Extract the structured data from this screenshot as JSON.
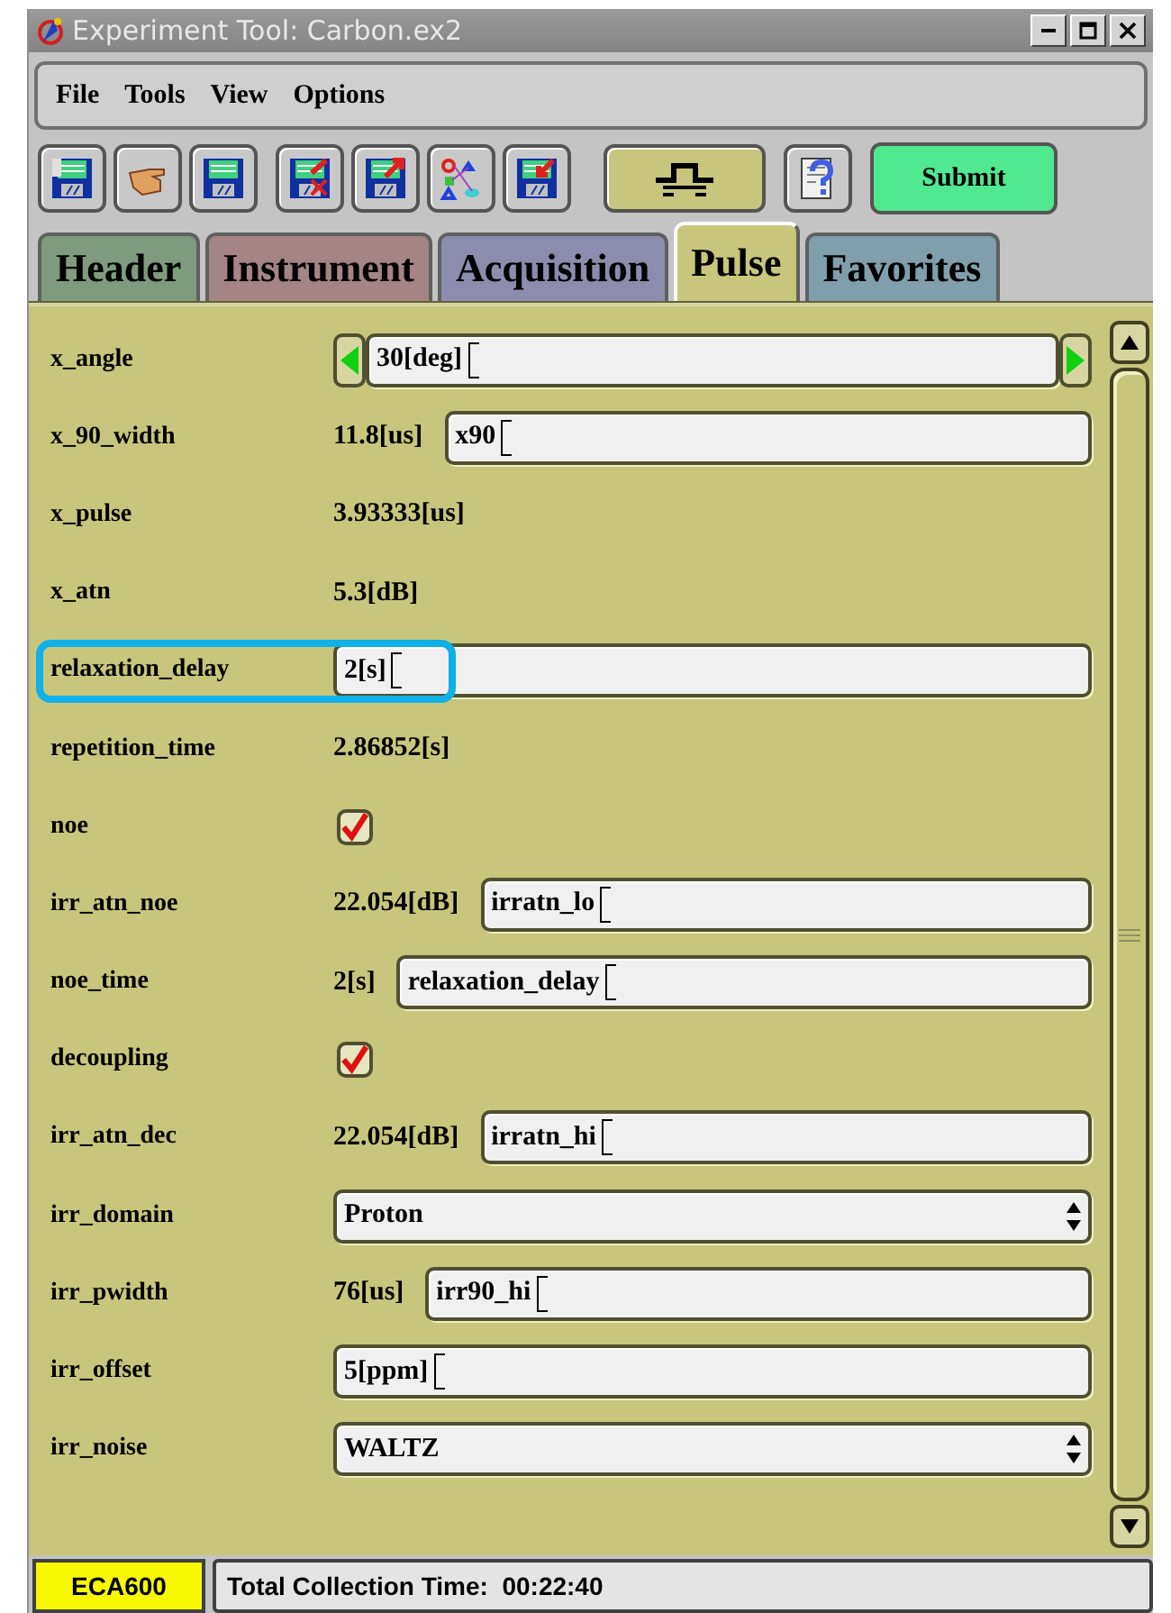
{
  "window": {
    "title": "Experiment Tool: Carbon.ex2"
  },
  "menu": [
    "File",
    "Tools",
    "View",
    "Options"
  ],
  "toolbar": {
    "submit": "Submit"
  },
  "tabs": [
    {
      "label": "Header",
      "selected": false,
      "color": "#7f9a7f"
    },
    {
      "label": "Instrument",
      "selected": false,
      "color": "#a48484"
    },
    {
      "label": "Acquisition",
      "selected": false,
      "color": "#8c8cac"
    },
    {
      "label": "Pulse",
      "selected": true,
      "color": "#c8c67c"
    },
    {
      "label": "Favorites",
      "selected": false,
      "color": "#7f9faa"
    }
  ],
  "rows": [
    {
      "kind": "stepper",
      "label": "x_angle",
      "value": "30[deg]",
      "highlighted": false
    },
    {
      "kind": "value_field",
      "label": "x_90_width",
      "reading": "11.8[us]",
      "value": "x90",
      "highlighted": false
    },
    {
      "kind": "reading",
      "label": "x_pulse",
      "reading": "3.93333[us]",
      "highlighted": false
    },
    {
      "kind": "reading",
      "label": "x_atn",
      "reading": "5.3[dB]",
      "highlighted": false
    },
    {
      "kind": "field",
      "label": "relaxation_delay",
      "value": "2[s]",
      "highlighted": true
    },
    {
      "kind": "reading",
      "label": "repetition_time",
      "reading": "2.86852[s]",
      "highlighted": false
    },
    {
      "kind": "checkbox",
      "label": "noe",
      "checked": true,
      "highlighted": false
    },
    {
      "kind": "value_field",
      "label": "irr_atn_noe",
      "reading": "22.054[dB]",
      "value": "irratn_lo",
      "highlighted": false
    },
    {
      "kind": "value_field",
      "label": "noe_time",
      "reading": "2[s]",
      "value": "relaxation_delay",
      "highlighted": false
    },
    {
      "kind": "checkbox",
      "label": "decoupling",
      "checked": true,
      "highlighted": false
    },
    {
      "kind": "value_field",
      "label": "irr_atn_dec",
      "reading": "22.054[dB]",
      "value": "irratn_hi",
      "highlighted": false
    },
    {
      "kind": "select",
      "label": "irr_domain",
      "value": "Proton",
      "highlighted": false
    },
    {
      "kind": "value_field",
      "label": "irr_pwidth",
      "reading": "76[us]",
      "value": "irr90_hi",
      "highlighted": false
    },
    {
      "kind": "field",
      "label": "irr_offset",
      "value": "5[ppm]",
      "highlighted": false
    },
    {
      "kind": "select",
      "label": "irr_noise",
      "value": "WALTZ",
      "highlighted": false
    }
  ],
  "status_bar": {
    "instrument": "ECA600",
    "message": "Total Collection Time:  00:22:40"
  }
}
